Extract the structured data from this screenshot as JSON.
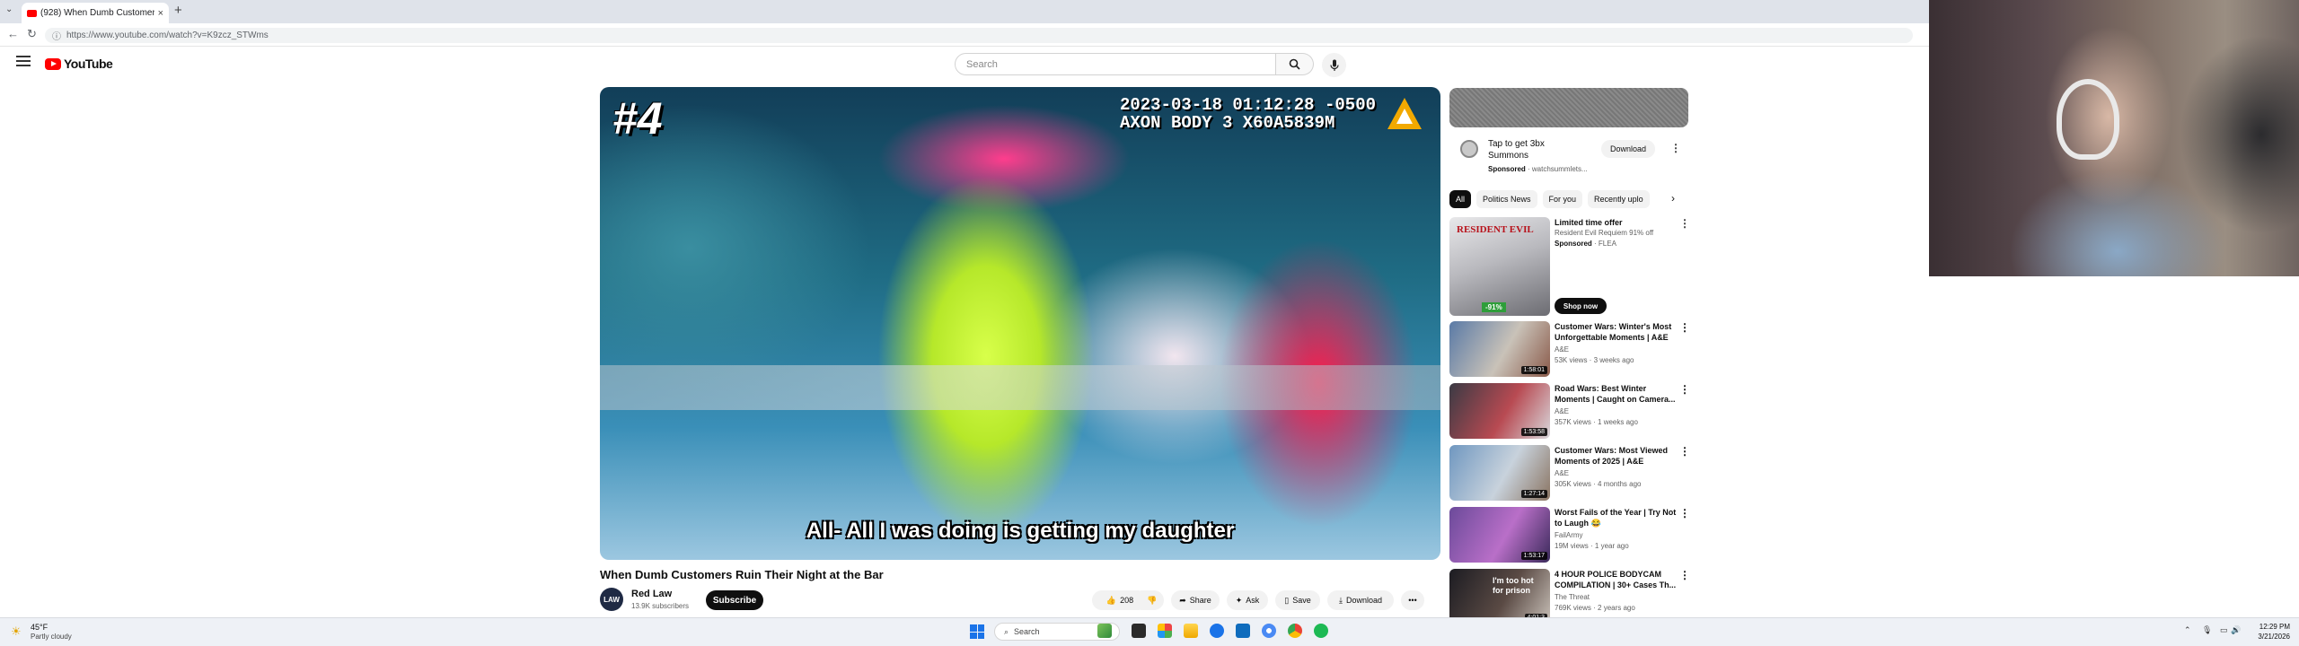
{
  "browser": {
    "tab_title": "(928) When Dumb Customers",
    "tab_close": "×",
    "new_tab": "+",
    "url": "https://www.youtube.com/watch?v=K9zcz_STWms"
  },
  "youtube": {
    "logo_text": "YouTube",
    "search_placeholder": "Search"
  },
  "video": {
    "overlay_rank": "#4",
    "overlay_stamp_line1": "2023-03-18 01:12:28 -0500",
    "overlay_stamp_line2": "AXON BODY 3 X60A5839M",
    "subtitle": "All- All I was doing is getting my daughter",
    "title": "When Dumb Customers Ruin Their Night at the Bar",
    "channel_name": "Red Law",
    "channel_avatar_text": "LAW",
    "channel_subs": "13.9K subscribers",
    "subscribe_label": "Subscribe",
    "like_count": "208",
    "share_label": "Share",
    "ask_label": "Ask",
    "save_label": "Save",
    "download_label": "Download",
    "more_label": "•••"
  },
  "sidebar": {
    "ad": {
      "title": "Tap to get 3bx Summons",
      "sponsored": "Sponsored",
      "advertiser": "· watchsummlets...",
      "download_label": "Download"
    },
    "chips": [
      "All",
      "Politics News",
      "For you",
      "Recently uplo"
    ],
    "promo": {
      "title": "Limited time offer",
      "subtitle": "Resident Evil Requiem 91% off",
      "sponsored": "Sponsored",
      "advertiser": "· FLEA",
      "thumb_text": "RESIDENT EVIL",
      "discount": "-91%",
      "shop_label": "Shop now"
    },
    "recommendations": [
      {
        "title": "Customer Wars: Winter's Most Unforgettable Moments | A&E",
        "channel": "A&E",
        "meta": "53K views · 3 weeks ago",
        "duration": "1:58:01",
        "thumb_text": "",
        "colors": [
          "#5a7aa6",
          "#c9c2b8",
          "#8a5a4a"
        ]
      },
      {
        "title": "Road Wars: Best Winter Moments | Caught on Camera...",
        "channel": "A&E",
        "meta": "357K views · 1 weeks ago",
        "duration": "1:53:58",
        "thumb_text": "",
        "colors": [
          "#3a3a44",
          "#b84a52",
          "#d8d8dc"
        ]
      },
      {
        "title": "Customer Wars: Most Viewed Moments of 2025 | A&E",
        "channel": "A&E",
        "meta": "305K views · 4 months ago",
        "duration": "1:27:14",
        "thumb_text": "",
        "colors": [
          "#6f97c0",
          "#c8d2dc",
          "#8a7462"
        ]
      },
      {
        "title": "Worst Fails of the Year | Try Not to Laugh 😂",
        "channel": "FailArmy",
        "meta": "19M views · 1 year ago",
        "duration": "1:53:17",
        "thumb_text": "",
        "colors": [
          "#6b4a9a",
          "#b96fc8",
          "#3a2a5a"
        ]
      },
      {
        "title": "4 HOUR POLICE BODYCAM COMPILATION | 30+ Cases Th...",
        "channel": "The Threat",
        "meta": "769K views · 2 years ago",
        "duration": "4:01:3",
        "thumb_text": "I'm too hot for prison",
        "colors": [
          "#1c1c22",
          "#5a4a44",
          "#c8c0b8"
        ]
      }
    ]
  },
  "taskbar": {
    "weather_temp": "45°F",
    "weather_cond": "Partly cloudy",
    "search_label": "Search",
    "time": "12:29 PM",
    "date": "3/21/2026"
  },
  "colors": {
    "yt_red": "#ff0000",
    "brand_black": "#0f0f0f",
    "chip_bg": "#f2f2f2",
    "taskbar_bg": "#eef1f6"
  }
}
